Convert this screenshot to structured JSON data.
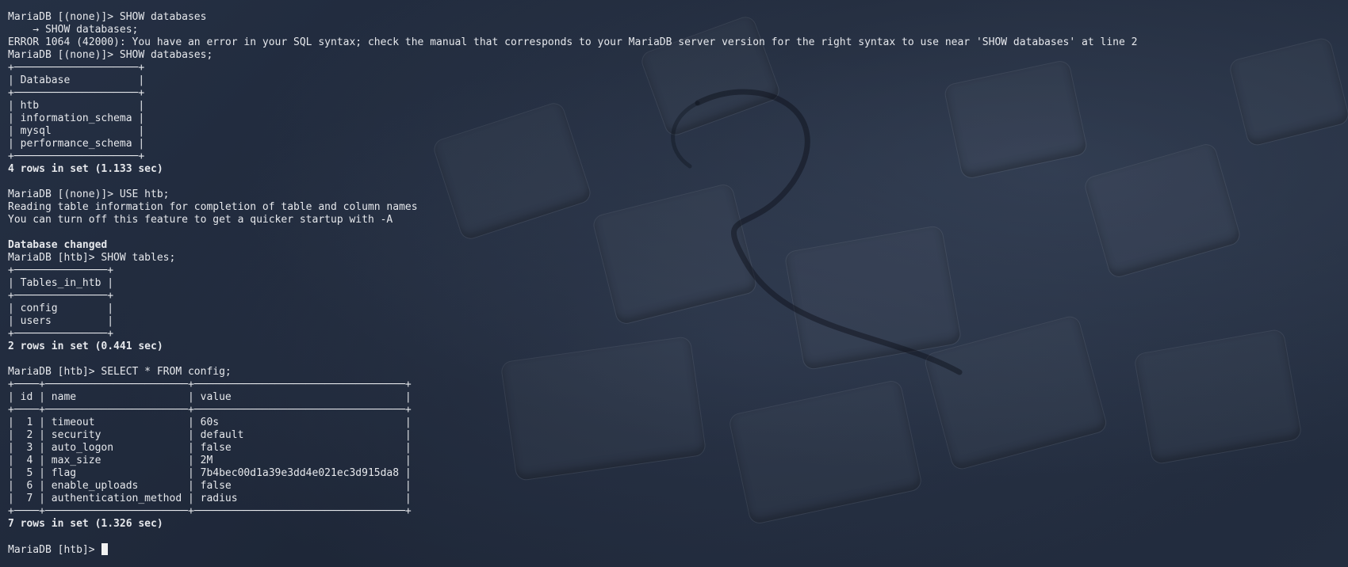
{
  "terminal": {
    "lines": [
      {
        "text": "MariaDB [(none)]> SHOW databases",
        "bold": false
      },
      {
        "text": "    → SHOW databases;",
        "bold": false
      },
      {
        "text": "ERROR 1064 (42000): You have an error in your SQL syntax; check the manual that corresponds to your MariaDB server version for the right syntax to use near 'SHOW databases' at line 2",
        "bold": false
      },
      {
        "text": "MariaDB [(none)]> SHOW databases;",
        "bold": false
      },
      {
        "text": "+────────────────────+",
        "bold": false
      },
      {
        "text": "| Database           |",
        "bold": false
      },
      {
        "text": "+────────────────────+",
        "bold": false
      },
      {
        "text": "| htb                |",
        "bold": false
      },
      {
        "text": "| information_schema |",
        "bold": false
      },
      {
        "text": "| mysql              |",
        "bold": false
      },
      {
        "text": "| performance_schema |",
        "bold": false
      },
      {
        "text": "+────────────────────+",
        "bold": false
      },
      {
        "text": "4 rows in set (1.133 sec)",
        "bold": true
      },
      {
        "text": "",
        "bold": false
      },
      {
        "text": "MariaDB [(none)]> USE htb;",
        "bold": false
      },
      {
        "text": "Reading table information for completion of table and column names",
        "bold": false
      },
      {
        "text": "You can turn off this feature to get a quicker startup with -A",
        "bold": false
      },
      {
        "text": "",
        "bold": false
      },
      {
        "text": "Database changed",
        "bold": true
      },
      {
        "text": "MariaDB [htb]> SHOW tables;",
        "bold": false
      },
      {
        "text": "+───────────────+",
        "bold": false
      },
      {
        "text": "| Tables_in_htb |",
        "bold": false
      },
      {
        "text": "+───────────────+",
        "bold": false
      },
      {
        "text": "| config        |",
        "bold": false
      },
      {
        "text": "| users         |",
        "bold": false
      },
      {
        "text": "+───────────────+",
        "bold": false
      },
      {
        "text": "2 rows in set (0.441 sec)",
        "bold": true
      },
      {
        "text": "",
        "bold": false
      },
      {
        "text": "MariaDB [htb]> SELECT * FROM config;",
        "bold": false
      },
      {
        "text": "+────+───────────────────────+──────────────────────────────────+",
        "bold": false
      },
      {
        "text": "| id | name                  | value                            |",
        "bold": false
      },
      {
        "text": "+────+───────────────────────+──────────────────────────────────+",
        "bold": false
      },
      {
        "text": "|  1 | timeout               | 60s                              |",
        "bold": false
      },
      {
        "text": "|  2 | security              | default                          |",
        "bold": false
      },
      {
        "text": "|  3 | auto_logon            | false                            |",
        "bold": false
      },
      {
        "text": "|  4 | max_size              | 2M                               |",
        "bold": false
      },
      {
        "text": "|  5 | flag                  | 7b4bec00d1a39e3dd4e021ec3d915da8 |",
        "bold": false
      },
      {
        "text": "|  6 | enable_uploads        | false                            |",
        "bold": false
      },
      {
        "text": "|  7 | authentication_method | radius                           |",
        "bold": false
      },
      {
        "text": "+────+───────────────────────+──────────────────────────────────+",
        "bold": false
      },
      {
        "text": "7 rows in set (1.326 sec)",
        "bold": true
      },
      {
        "text": "",
        "bold": false
      }
    ],
    "prompt": "MariaDB [htb]> ",
    "colors": {
      "foreground": "#e6e8ec",
      "background": "#1f2838",
      "cursor": "#f2f2f2"
    }
  }
}
